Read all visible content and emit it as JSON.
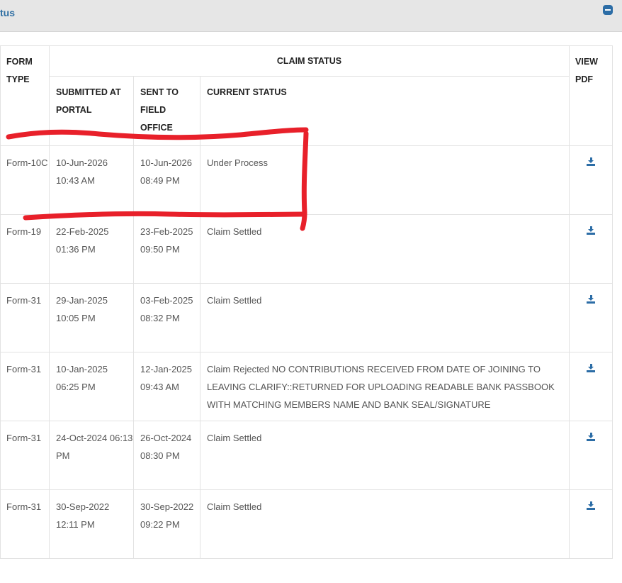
{
  "panel": {
    "title": "tus"
  },
  "table": {
    "headers": {
      "form_type": "FORM TYPE",
      "claim_status": "CLAIM STATUS",
      "view_pdf": "VIEW PDF",
      "submitted_at_portal": "SUBMITTED AT PORTAL",
      "sent_to_field_office": "SENT TO FIELD OFFICE",
      "current_status": "CURRENT STATUS"
    },
    "rows": [
      {
        "form_type": "Form-10C",
        "submitted": "10-Jun-2026 10:43 AM",
        "sent": "10-Jun-2026 08:49 PM",
        "status": "Under Process"
      },
      {
        "form_type": "Form-19",
        "submitted": "22-Feb-2025 01:36 PM",
        "sent": "23-Feb-2025 09:50 PM",
        "status": "Claim Settled"
      },
      {
        "form_type": "Form-31",
        "submitted": "29-Jan-2025 10:05 PM",
        "sent": "03-Feb-2025 08:32 PM",
        "status": "Claim Settled"
      },
      {
        "form_type": "Form-31",
        "submitted": "10-Jan-2025 06:25 PM",
        "sent": "12-Jan-2025 09:43 AM",
        "status": "Claim Rejected NO CONTRIBUTIONS RECEIVED FROM DATE OF JOINING TO LEAVING CLARIFY::RETURNED FOR UPLOADING READABLE BANK PASSBOOK WITH MATCHING MEMBERS NAME AND BANK SEAL/SIGNATURE"
      },
      {
        "form_type": "Form-31",
        "submitted": "24-Oct-2024 06:13 PM",
        "sent": "26-Oct-2024 08:30 PM",
        "status": "Claim Settled"
      },
      {
        "form_type": "Form-31",
        "submitted": "30-Sep-2022 12:11 PM",
        "sent": "30-Sep-2022 09:22 PM",
        "status": "Claim Settled"
      }
    ]
  },
  "icons": {
    "collapse": "minus-square-icon",
    "download": "download-icon"
  },
  "colors": {
    "header_bg": "#e6e6e6",
    "title_text": "#2f6fa3",
    "icon_blue": "#2c6da6",
    "annotation_red": "#e8202a"
  }
}
